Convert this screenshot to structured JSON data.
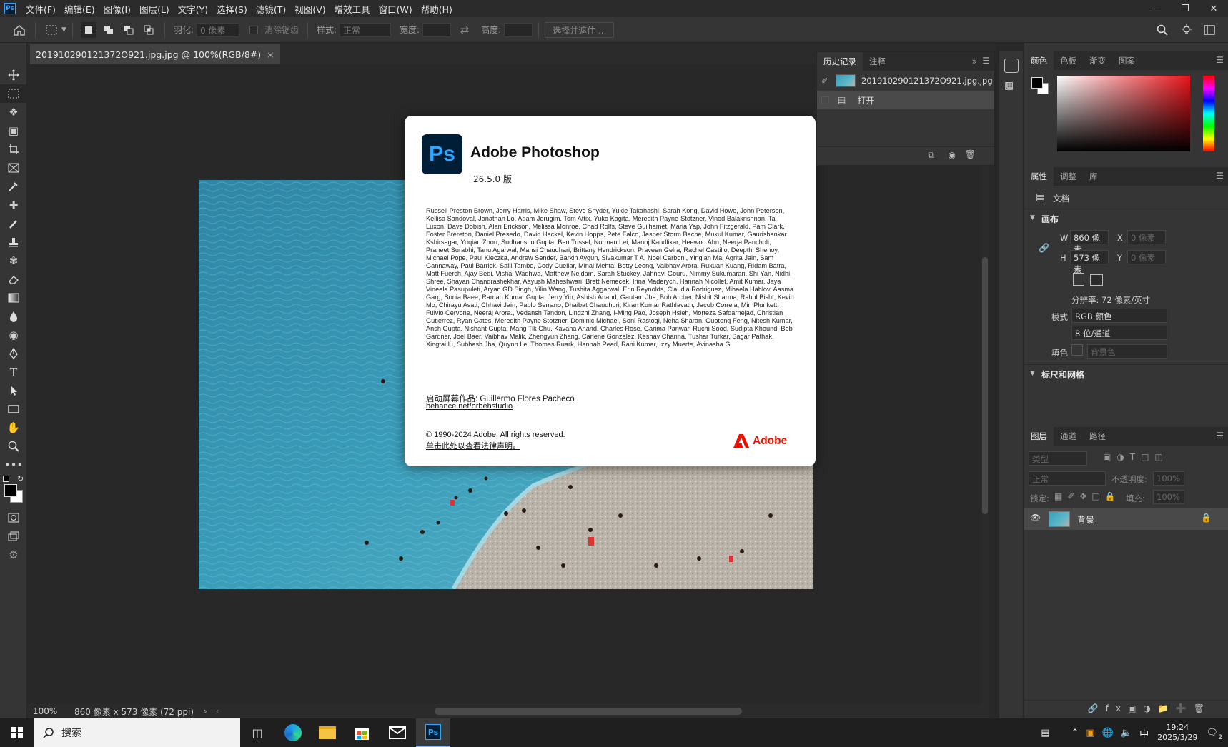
{
  "menu": {
    "items": [
      "文件(F)",
      "编辑(E)",
      "图像(I)",
      "图层(L)",
      "文字(Y)",
      "选择(S)",
      "滤镜(T)",
      "视图(V)",
      "增效工具",
      "窗口(W)",
      "帮助(H)"
    ]
  },
  "options": {
    "feather_label": "羽化:",
    "feather_value": "0 像素",
    "antialias_label": "消除锯齿",
    "style_label": "样式:",
    "style_value": "正常",
    "width_label": "宽度:",
    "height_label": "高度:",
    "select_mask_button": "选择并遮住 ..."
  },
  "document": {
    "tab_title": "201910290121372O921.jpg.jpg @ 100%(RGB/8#)",
    "zoom": "100%",
    "info": "860 像素 x 573 像素 (72 ppi)"
  },
  "about": {
    "logo_text": "Ps",
    "title": "Adobe Photoshop",
    "version": "26.5.0 版",
    "credits": "Russell Preston Brown, Jerry Harris, Mike Shaw, Steve Snyder, Yukie Takahashi, Sarah Kong, David Howe, John Peterson, Kellisa Sandoval, Jonathan Lo, Adam Jerugim, Tom Attix, Yuko Kagita, Meredith Payne-Stotzner, Vinod Balakrishnan, Tai Luxon, Dave Dobish, Alan Erickson, Melissa Monroe, Chad Rolfs, Steve Guilhamet, Maria Yap, John Fitzgerald, Pam Clark, Foster Brereton, Daniel Presedo, David Hackel, Kevin Hopps, Pete Falco, Jesper Storm Bache, Mukul Kumar, Gaurishankar Kshirsagar, Yuqian Zhou, Sudhanshu Gupta, Ben Trissel, Norman Lei, Manoj Kandlikar, Heewoo Ahn, Neerja Pancholi, Praneet Surabhi, Tanu Agarwal, Mansi Chaudhari, Brittany Hendrickson, Praveen Gelra, Rachel Castillo, Deepthi Shenoy, Michael Pope, Paul Kleczka, Andrew Sender, Barkin Aygun, Sivakumar T A, Noel Carboni, Yinglan Ma, Agrita Jain, Sam Gannaway, Paul Barrick, Salil Tambe, Cody Cuellar, Minal Mehta, Betty Leong, Vaibhav Arora, Ruxuan Kuang, Ridam Batra, Matt Fuerch, Ajay Bedi, Vishal Wadhwa, Matthew Neldam, Sarah Stuckey, Jahnavi Gouru, Nimmy Sukumaran, Shi Yan, Nidhi Shree, Shayan Chandrashekhar, Aayush Maheshwari, Brett Nemecek, Irina Maderych, Hannah Nicollet, Amit Kumar, Jaya Vineela Pasupuleti, Aryan GD Singh, Yilin Wang, Tushita Aggarwal, Erin Reynolds, Claudia Rodriguez, Mihaela Hahlov, Aasma Garg, Sonia Baee, Raman Kumar Gupta, Jerry Yin, Ashish Anand, Gautam Jha, Bob Archer, Nishit Sharma, Rahul Bisht, Kevin Mo, Chirayu Asati, Chhavi Jain, Pablo Serrano, Dhaibat Chaudhuri, Kiran Kumar Rathlavath, Jacob Correia, Min Plunkett, Fulvio Cervone, Neeraj Arora., Vedansh Tandon, Lingzhi Zhang, I-Ming Pao, Joseph Hsieh, Morteza Safdarnejad, Christian Gutierrez, Ryan Gates, Meredith Payne Stotzner, Dominic Michael, Soni Rastogi, Neha Sharan, Guotong Feng, Nitesh Kumar, Ansh Gupta, Nishant Gupta, Mang Tik Chu, Kavana Anand, Charles Rose, Garima Panwar, Ruchi Sood, Sudipta Khound, Bob Gardner, Joel Baer, Vaibhav Malik, Zhengyun Zhang, Carlene Gonzalez, Keshav Channa, Tushar Turkar, Sagar Pathak, Xingtai Li, Subhash Jha, Quynn Le, Thomas Ruark, Hannah Pearl, Rani Kumar, Izzy Muerte, Avinasha G",
    "splash_label": "启动屏幕作品: Guillermo Flores Pacheco",
    "splash_link": "behance.net/orbehstudio",
    "copyright": "© 1990-2024 Adobe. All rights reserved.",
    "legal_link": "单击此处以查看法律声明。",
    "adobe_word": "Adobe",
    "adobe_red": "#eb1000",
    "ps_blue": "#31a8ff"
  },
  "history": {
    "tabs": [
      "历史记录",
      "注释"
    ],
    "snapshot": "201910290121372O921.jpg.jpg",
    "step": "打开"
  },
  "color_panel": {
    "tabs": [
      "颜色",
      "色板",
      "渐变",
      "图案"
    ]
  },
  "properties": {
    "tabs": [
      "属性",
      "调整",
      "库"
    ],
    "doc_label": "文档",
    "canvas_header": "画布",
    "w_label": "W",
    "w_value": "860 像素",
    "h_label": "H",
    "h_value": "573 像素",
    "x_label": "X",
    "x_value": "0 像素",
    "y_label": "Y",
    "y_value": "0 像素",
    "resolution": "分辨率: 72 像素/英寸",
    "mode_label": "模式",
    "mode_value": "RGB 颜色",
    "depth_value": "8 位/通道",
    "fill_label": "填色",
    "fill_value": "背景色",
    "rulers_header": "标尺和网格"
  },
  "layers": {
    "tabs": [
      "图层",
      "通道",
      "路径"
    ],
    "kind_placeholder": "类型",
    "blend_mode": "正常",
    "opacity_label": "不透明度:",
    "opacity_value": "100%",
    "lock_label": "锁定:",
    "fill_label": "填充:",
    "fill_value": "100%",
    "layer_name": "背景"
  },
  "taskbar": {
    "search_label": "搜索",
    "ime": "中",
    "time": "19:24",
    "date": "2025/3/29",
    "notif_count": "2"
  }
}
